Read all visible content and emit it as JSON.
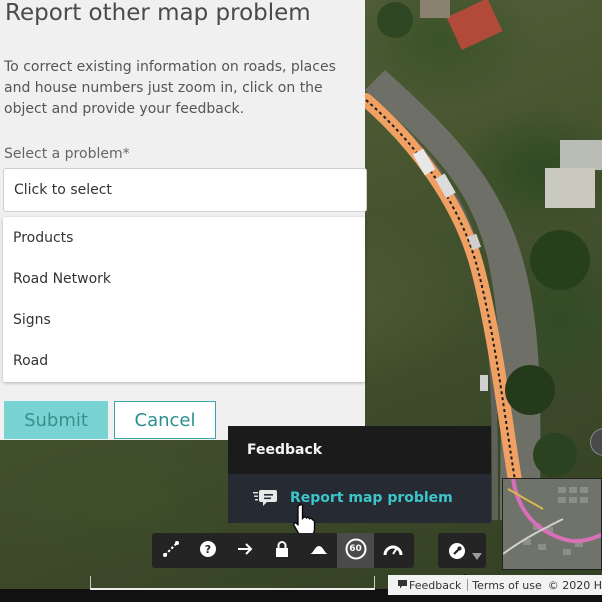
{
  "panel": {
    "title": "Report other map problem",
    "description": "To correct existing information on roads, places and house numbers just zoom in, click on the object and provide your feedback.",
    "select_label": "Select a problem*",
    "select_value": "Click to select",
    "options": [
      "Products",
      "Road Network",
      "Signs",
      "Road"
    ],
    "submit_label": "Submit",
    "cancel_label": "Cancel"
  },
  "feedback_menu": {
    "header": "Feedback",
    "item_label": "Report map problem",
    "item_icon": "report-feedback-icon"
  },
  "toolbar": {
    "tools": [
      "measure-icon",
      "help-icon",
      "arrow-right-icon",
      "lock-icon",
      "terrain-icon",
      "speed-limit-60-icon",
      "speedometer-icon"
    ],
    "speed_limit": "60",
    "active_tool": "speed-limit-60-icon",
    "right_tool": "wrench-icon"
  },
  "footer": {
    "feedback_label": "Feedback",
    "terms_label": "Terms of use",
    "copyright": "© 2020 H"
  },
  "colors": {
    "accent": "#3cc6cc",
    "submit_bg": "#7ad3d3",
    "road": "#f0a062",
    "panel_bg": "#f0f0f0"
  }
}
